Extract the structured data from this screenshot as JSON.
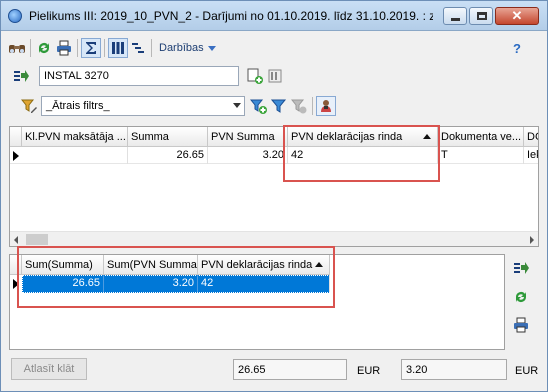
{
  "window": {
    "title": "Pielikums III: 2019_10_PVN_2 - Darījumi no 01.10.2019. līdz 31.10.2019. : zem..."
  },
  "toolbar": {
    "actions_label": "Darbības",
    "help_label": "?"
  },
  "account_combo": {
    "value": "INSTAL 3270"
  },
  "filter_combo": {
    "value": "_Ātrais filtrs_"
  },
  "main_grid": {
    "columns": [
      "Kl.PVN maksātāja ...",
      "Summa",
      "PVN Summa",
      "PVN deklarācijas rinda",
      "Dokumenta ve...",
      "DG"
    ],
    "row": [
      "",
      "26.65",
      "3.20",
      "42",
      "T",
      "Iek"
    ]
  },
  "summary_grid": {
    "columns": [
      "Sum(Summa)",
      "Sum(PVN Summa)",
      "PVN deklarācijas rinda"
    ],
    "row": [
      "26.65",
      "3.20",
      "42"
    ]
  },
  "footer": {
    "clear_button": "Atlasīt klāt",
    "total_sum": "26.65",
    "currency1": "EUR",
    "total_vat": "3.20",
    "currency2": "EUR"
  },
  "colors": {
    "highlight": "#d9534f",
    "selection": "#0078d7",
    "title_gradient_top": "#c9dff5"
  }
}
